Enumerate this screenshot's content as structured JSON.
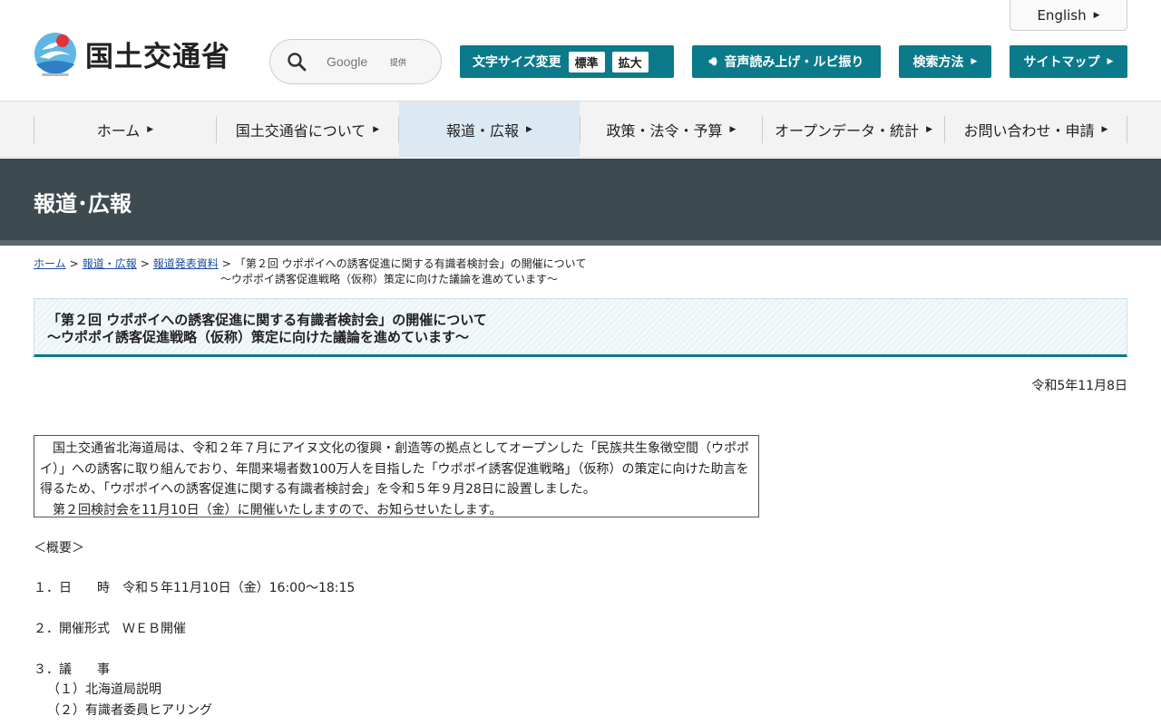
{
  "header": {
    "logo_text": "国土交通省",
    "english_label": "English",
    "search": {
      "placeholder": "Google",
      "provided_label": "提供"
    },
    "font_size": {
      "label": "文字サイズ変更",
      "standard": "標準",
      "large": "拡大"
    },
    "voice_label": "音声読み上げ・ルビ振り",
    "search_method_label": "検索方法",
    "sitemap_label": "サイトマップ"
  },
  "nav": {
    "items": [
      {
        "label": "ホーム"
      },
      {
        "label": "国土交通省について"
      },
      {
        "label": "報道・広報"
      },
      {
        "label": "政策・法令・予算"
      },
      {
        "label": "オープンデータ・統計"
      },
      {
        "label": "お問い合わせ・申請"
      }
    ]
  },
  "section_title": "報道･広報",
  "breadcrumb": {
    "home": "ホーム",
    "press": "報道・広報",
    "releases": "報道発表資料",
    "current_line1": "「第２回 ウポポイへの誘客促進に関する有識者検討会」の開催について",
    "current_line2": "～ウポポイ誘客促進戦略（仮称）策定に向けた議論を進めています～"
  },
  "article": {
    "title_line1": "「第２回 ウポポイへの誘客促進に関する有識者検討会」の開催について",
    "title_line2": "～ウポポイ誘客促進戦略（仮称）策定に向けた議論を進めています～",
    "date": "令和5年11月8日",
    "summary_p1": "国土交通省北海道局は、令和２年７月にアイヌ文化の復興・創造等の拠点としてオープンした「民族共生象徴空間（ウポポイ）」への誘客に取り組んでおり、年間来場者数100万人を目指した「ウポポイ誘客促進戦略」（仮称）の策定に向けた助言を得るため、「ウポポイへの誘客促進に関する有識者検討会」を令和５年９月28日に設置しました。",
    "summary_p2": "第２回検討会を11月10日（金）に開催いたしますので、お知らせいたします。",
    "overview_heading": "＜概要＞",
    "item1": "１．日　　時　令和５年11月10日（金）16:00～18:15",
    "item2": "２．開催形式　ＷＥＢ開催",
    "item3": "３．議　　事",
    "item3_1": "（１）北海道局説明",
    "item3_2": "（２）有識者委員ヒアリング"
  }
}
